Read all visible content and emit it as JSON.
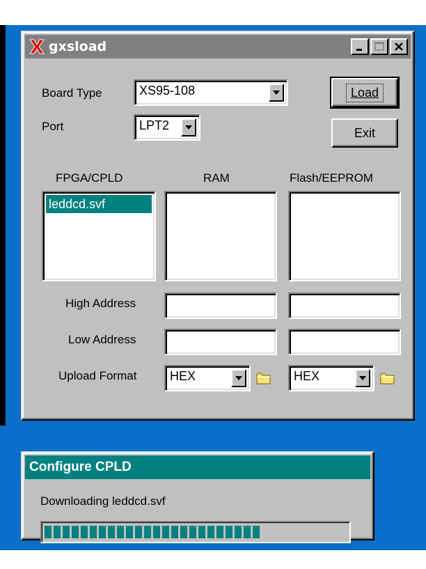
{
  "main_window": {
    "title": "gxsload",
    "board_type_label": "Board Type",
    "board_type_value": "XS95-108",
    "port_label": "Port",
    "port_value": "LPT2",
    "load_button": "Load",
    "exit_button": "Exit",
    "columns": {
      "fpga": "FPGA/CPLD",
      "ram": "RAM",
      "flash": "Flash/EEPROM"
    },
    "fpga_files": [
      "leddcd.svf"
    ],
    "high_address_label": "High Address",
    "low_address_label": "Low Address",
    "upload_format_label": "Upload Format",
    "ram_upload_format": "HEX",
    "flash_upload_format": "HEX"
  },
  "progress_dialog": {
    "title": "Configure CPLD",
    "message": "Downloading leddcd.svf",
    "progress": 0.71,
    "accent": "#008080"
  }
}
